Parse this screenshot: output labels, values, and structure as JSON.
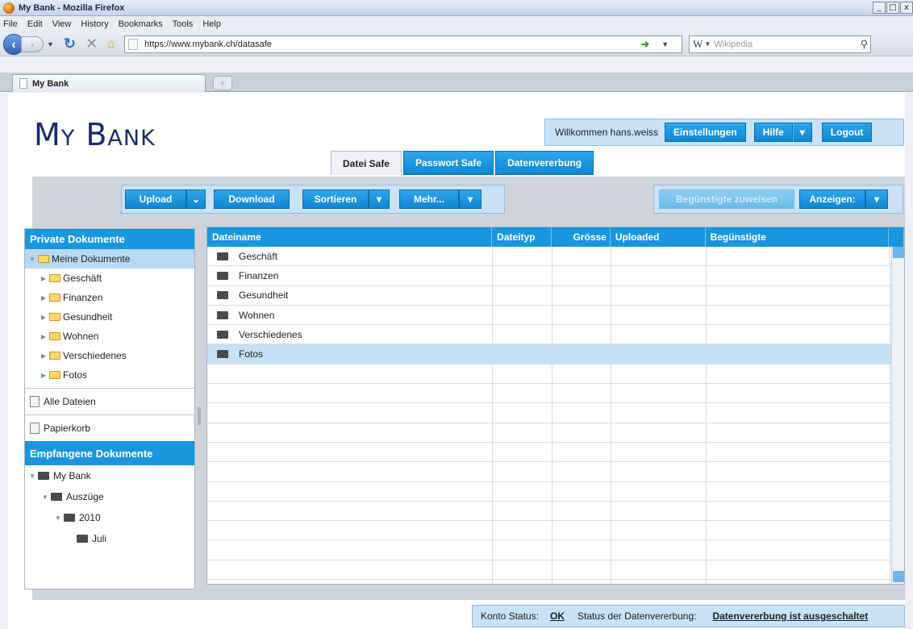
{
  "browser": {
    "window_title": "My Bank - Mozilla Firefox",
    "window_buttons": [
      "_",
      "□",
      "x"
    ],
    "menu": [
      "File",
      "Edit",
      "View",
      "History",
      "Bookmarks",
      "Tools",
      "Help"
    ],
    "url": "https://www.mybank.ch/datasafe",
    "search_placeholder": "Wikipedia",
    "search_engine_glyph": "W",
    "tab_title": "My Bank",
    "new_tab_glyph": "+"
  },
  "header": {
    "brand": "My Bank",
    "welcome": "Willkommen hans.weiss",
    "settings": "Einstellungen",
    "help": "Hilfe",
    "dropdown_glyph": "▾",
    "logout": "Logout"
  },
  "main_tabs": [
    {
      "label": "Datei Safe",
      "active": true
    },
    {
      "label": "Passwort Safe",
      "active": false
    },
    {
      "label": "Datenvererbung",
      "active": false
    }
  ],
  "toolbar": {
    "upload": "Upload",
    "upload_dd": "⌄",
    "download": "Download",
    "sort": "Sortieren",
    "more": "Mehr...",
    "assign": "Begünstigte zuweisen",
    "view": "Anzeigen:"
  },
  "sidebar": {
    "private_header": "Private Dokumente",
    "root": "Meine Dokumente",
    "folders": [
      "Geschäft",
      "Finanzen",
      "Gesundheit",
      "Wohnen",
      "Verschiedenes",
      "Fotos"
    ],
    "all_files": "Alle Dateien",
    "trash": "Papierkorb",
    "received_header": "Empfangene Dokumente",
    "received_tree": [
      "My Bank",
      "Auszüge",
      "2010",
      "Juli"
    ]
  },
  "grid": {
    "columns": [
      "Dateiname",
      "Dateityp",
      "Grösse",
      "Uploaded",
      "Begünstigte"
    ],
    "rows": [
      "Geschäft",
      "Finanzen",
      "Gesundheit",
      "Wohnen",
      "Verschiedenes",
      "Fotos"
    ],
    "selected_row": "Fotos"
  },
  "status": {
    "konto_label": "Konto Status:",
    "konto_value": "OK",
    "erbe_label": "Status der Datenvererbung:",
    "erbe_value": "Datenvererbung ist ausgeschaltet"
  },
  "colors": {
    "accent_blue": "#1897de",
    "light_panel": "#c9e2f5",
    "selection": "#b8d9f3",
    "brand_text": "#1a2b6d"
  }
}
